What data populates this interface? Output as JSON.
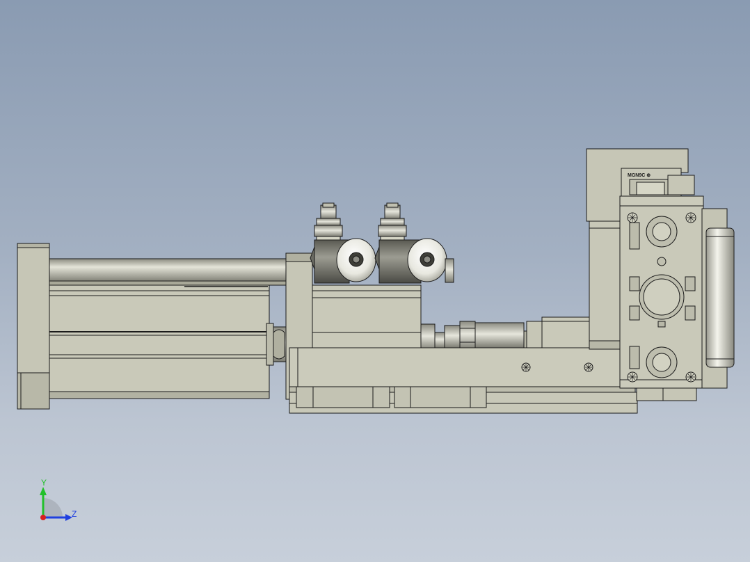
{
  "viewport": {
    "model_label": "MGN9C ⊕",
    "triad": {
      "y_label": "Y",
      "z_label": "Z",
      "y_color": "#22c02a",
      "z_color": "#1f3fe0",
      "x_color": "#d82020"
    },
    "colors": {
      "part_fill": "#c8c8b8",
      "part_fill_dark": "#a8a898",
      "part_fill_light": "#dcdccc",
      "edge": "#1a1a1a",
      "background_top": "#8a9bb2",
      "background_bottom": "#c7cfda"
    }
  }
}
